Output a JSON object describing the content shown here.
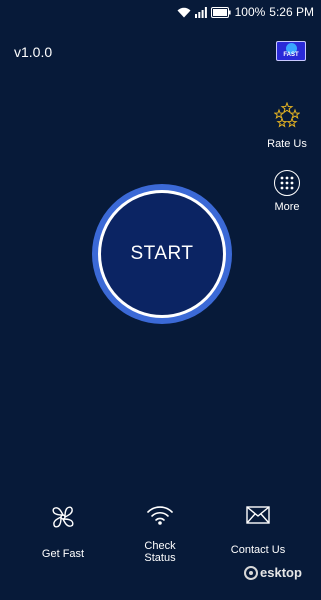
{
  "status_bar": {
    "battery": "100%",
    "time": "5:26 PM"
  },
  "app": {
    "version": "v1.0.0",
    "badge_text": "FAST"
  },
  "side_actions": {
    "rate_label": "Rate Us",
    "more_label": "More"
  },
  "main": {
    "start_label": "START"
  },
  "bottom_nav": {
    "get_fast": "Get Fast",
    "check_status": "Check Status",
    "contact_us": "Contact Us"
  },
  "watermark": {
    "text": "esktop"
  },
  "colors": {
    "background": "#071a39",
    "ring": "#3b69d6",
    "button": "#0b2463",
    "star": "#e6b422"
  }
}
